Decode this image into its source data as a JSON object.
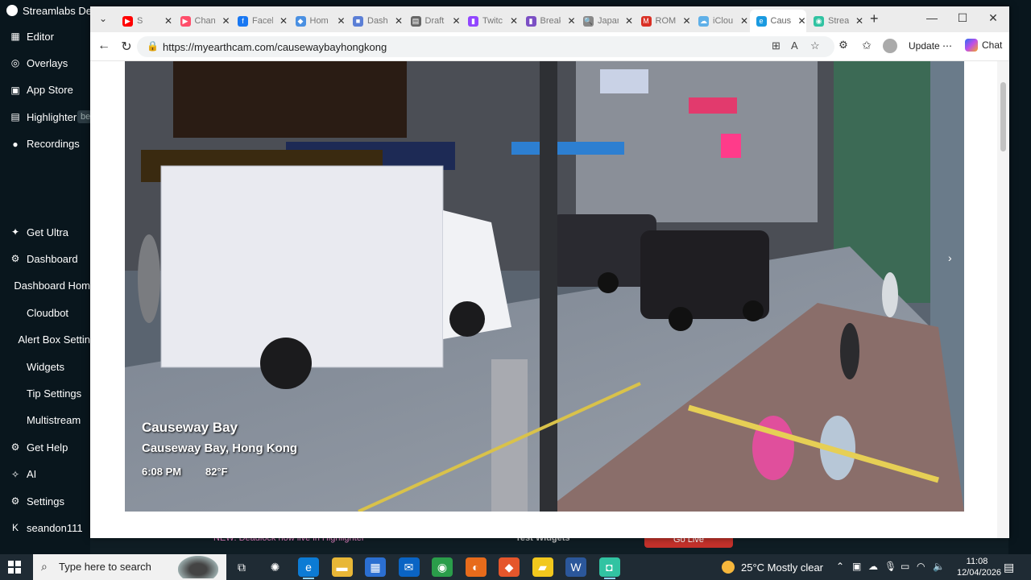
{
  "streamlabs": {
    "title": "Streamlabs De",
    "nav_top": [
      {
        "label": "Editor",
        "icon": "dashboard-icon",
        "glyph": "▦"
      },
      {
        "label": "Overlays",
        "icon": "overlays-icon",
        "glyph": "◎"
      },
      {
        "label": "App Store",
        "icon": "app-store-icon",
        "glyph": "▣"
      },
      {
        "label": "Highlighter",
        "icon": "highlighter-icon",
        "glyph": "▤"
      },
      {
        "label": "Recordings",
        "icon": "recordings-icon",
        "glyph": "●"
      }
    ],
    "beta_badge": "be",
    "nav_bottom": [
      {
        "label": "Get Ultra",
        "icon": "ultra-icon",
        "glyph": "✦"
      },
      {
        "label": "Dashboard",
        "icon": "dashboard-icon",
        "glyph": "⚙"
      },
      {
        "label": "Dashboard Hom",
        "icon": "",
        "glyph": ""
      },
      {
        "label": "Cloudbot",
        "icon": "",
        "glyph": ""
      },
      {
        "label": "Alert Box Settin",
        "icon": "",
        "glyph": ""
      },
      {
        "label": "Widgets",
        "icon": "",
        "glyph": ""
      },
      {
        "label": "Tip Settings",
        "icon": "",
        "glyph": ""
      },
      {
        "label": "Multistream",
        "icon": "",
        "glyph": ""
      },
      {
        "label": "Get Help",
        "icon": "help-icon",
        "glyph": "⚙"
      },
      {
        "label": "AI",
        "icon": "ai-icon",
        "glyph": "✧"
      },
      {
        "label": "Settings",
        "icon": "settings-icon",
        "glyph": "⚙"
      },
      {
        "label": "seandon111",
        "icon": "kick-icon",
        "glyph": "K"
      }
    ],
    "news": "NEW: Deadlock now live in Highlighter",
    "test_widgets": "Test Widgets",
    "go_live": "Go Live"
  },
  "browser": {
    "tabs": [
      {
        "label": "S",
        "color": "#ff0000",
        "glyph": "▶"
      },
      {
        "label": "Chan",
        "color": "#ff4e6a",
        "glyph": "▶"
      },
      {
        "label": "Faceb",
        "color": "#1877f2",
        "glyph": "f"
      },
      {
        "label": "Hom",
        "color": "#4a90e2",
        "glyph": "◆"
      },
      {
        "label": "Dash",
        "color": "#5b7fd6",
        "glyph": "■"
      },
      {
        "label": "Draft",
        "color": "#666666",
        "glyph": "▤"
      },
      {
        "label": "Twitc",
        "color": "#9146ff",
        "glyph": "▮"
      },
      {
        "label": "Break",
        "color": "#7b4fc4",
        "glyph": "▮"
      },
      {
        "label": "Japan",
        "color": "#888888",
        "glyph": "🔍"
      },
      {
        "label": "ROM",
        "color": "#d93025",
        "glyph": "M"
      },
      {
        "label": "iClou",
        "color": "#5fb0e8",
        "glyph": "☁"
      },
      {
        "label": "Caus",
        "color": "#1a9ae0",
        "glyph": "e",
        "active": true
      },
      {
        "label": "Strea",
        "color": "#31c3a2",
        "glyph": "◉"
      }
    ],
    "url": "https://myearthcam.com/causewaybayhongkong",
    "update_label": "Update",
    "chat_label": "Chat"
  },
  "camera": {
    "title": "Causeway Bay",
    "location": "Causeway Bay, Hong Kong",
    "time": "6:08 PM",
    "temperature": "82°F"
  },
  "taskbar": {
    "search_placeholder": "Type here to search",
    "weather": "25°C  Mostly clear",
    "time": "11:08",
    "date": "12/04/2026",
    "apps": [
      {
        "name": "task-view-icon",
        "glyph": "⧉",
        "color": "transparent"
      },
      {
        "name": "copilot-icon",
        "glyph": "✺",
        "color": "transparent"
      },
      {
        "name": "edge-icon",
        "glyph": "e",
        "color": "#0c7bd4",
        "active": true
      },
      {
        "name": "file-explorer-icon",
        "glyph": "▬",
        "color": "#e8b737"
      },
      {
        "name": "store-icon",
        "glyph": "▦",
        "color": "#2b6fd1"
      },
      {
        "name": "outlook-icon",
        "glyph": "✉",
        "color": "#0a64c4"
      },
      {
        "name": "chrome-icon",
        "glyph": "◉",
        "color": "#2a9d4a"
      },
      {
        "name": "firefox-icon",
        "glyph": "◐",
        "color": "#e76b1b"
      },
      {
        "name": "brave-icon",
        "glyph": "◆",
        "color": "#e5562b"
      },
      {
        "name": "sticky-notes-icon",
        "glyph": "▰",
        "color": "#f2c81d"
      },
      {
        "name": "word-icon",
        "glyph": "W",
        "color": "#2b579a"
      },
      {
        "name": "streamlabs-icon",
        "glyph": "◘",
        "color": "#31c3a2",
        "active": true
      }
    ]
  }
}
